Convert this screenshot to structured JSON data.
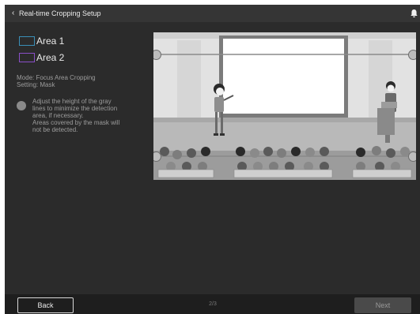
{
  "header": {
    "back_icon": "chevron-left",
    "title": "Real-time Cropping Setup",
    "bell_icon": "bell-icon"
  },
  "legend": [
    {
      "label": "Area 1",
      "color": "#3a8fb8"
    },
    {
      "label": "Area 2",
      "color": "#8a4fc7"
    }
  ],
  "info": {
    "mode": "Mode: Focus Area Cropping",
    "setting": "Setting: Mask"
  },
  "hint": {
    "line1": "Adjust the height of the gray",
    "line2": "lines to minimize the detection",
    "line3": "area, if necessary.",
    "line4": "Areas covered by the mask will",
    "line5": "not be detected."
  },
  "footer": {
    "back_label": "Back",
    "page_indicator": "2/3",
    "next_label": "Next"
  }
}
